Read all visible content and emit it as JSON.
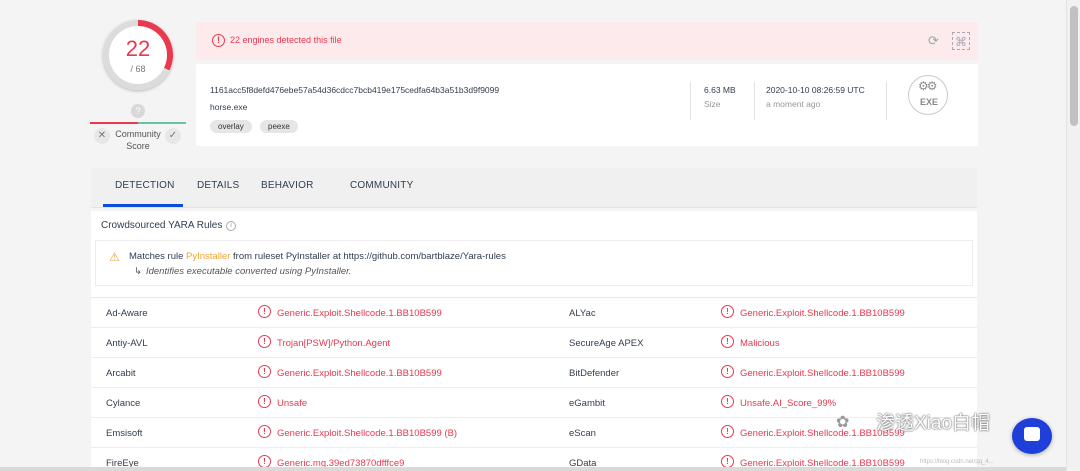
{
  "score": {
    "detected": "22",
    "total": "/ 68",
    "unknown_badge": "?",
    "community_label": "Community\nScore"
  },
  "alert": {
    "text": "22 engines detected this file"
  },
  "file": {
    "hash": "1161acc5f8defd476ebe57a54d36cdcc7bcb419e175cedfa64b3a51b3d9f9099",
    "name": "horse.exe",
    "tags": [
      "overlay",
      "peexe"
    ],
    "size_value": "6.63 MB",
    "size_label": "Size",
    "date_value": "2020-10-10 08:26:59 UTC",
    "date_label": "a moment ago",
    "type_badge": "EXE"
  },
  "tabs": [
    "DETECTION",
    "DETAILS",
    "BEHAVIOR",
    "COMMUNITY"
  ],
  "yara": {
    "title": "Crowdsourced YARA Rules",
    "prefix": "Matches rule ",
    "rule": "PyInstaller",
    "suffix": " from ruleset PyInstaller at https://github.com/bartblaze/Yara-rules",
    "description": "Identifies executable converted using PyInstaller."
  },
  "detections": [
    {
      "engine_l": "Ad-Aware",
      "result_l": "Generic.Exploit.Shellcode.1.BB10B599",
      "engine_r": "ALYac",
      "result_r": "Generic.Exploit.Shellcode.1.BB10B599"
    },
    {
      "engine_l": "Antiy-AVL",
      "result_l": "Trojan[PSW]/Python.Agent",
      "engine_r": "SecureAge APEX",
      "result_r": "Malicious"
    },
    {
      "engine_l": "Arcabit",
      "result_l": "Generic.Exploit.Shellcode.1.BB10B599",
      "engine_r": "BitDefender",
      "result_r": "Generic.Exploit.Shellcode.1.BB10B599"
    },
    {
      "engine_l": "Cylance",
      "result_l": "Unsafe",
      "engine_r": "eGambit",
      "result_r": "Unsafe.AI_Score_99%"
    },
    {
      "engine_l": "Emsisoft",
      "result_l": "Generic.Exploit.Shellcode.1.BB10B599 (B)",
      "engine_r": "eScan",
      "result_r": "Generic.Exploit.Shellcode.1.BB10B599"
    },
    {
      "engine_l": "FireEye",
      "result_l": "Generic.mg.39ed73870dfffce9",
      "engine_r": "GData",
      "result_r": "Generic.Exploit.Shellcode.1.BB10B599"
    }
  ],
  "watermark": {
    "text": "渗透Xiao白帽",
    "csdn": "https://blog.csdn.net/qq_4..."
  },
  "colors": {
    "danger": "#e9394f",
    "accent": "#0b4dda",
    "warning": "#f2a33a"
  }
}
